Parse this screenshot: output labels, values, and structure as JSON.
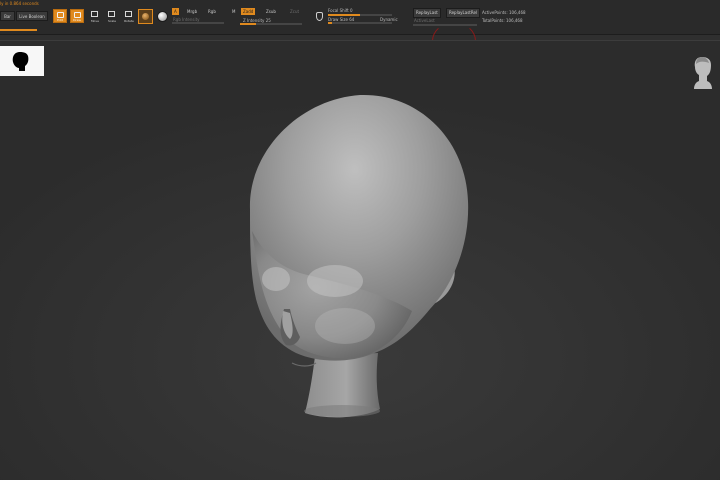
{
  "status": {
    "message": "ly in 0.864 seconds",
    "progress_fraction": 0.05
  },
  "left_buttons": {
    "clear_label": "Bar",
    "live_boolean_label": "Live Boolean"
  },
  "tools": [
    {
      "label": "Edit",
      "icon": "edit-icon",
      "active": true
    },
    {
      "label": "Draw",
      "icon": "draw-icon",
      "active": true
    },
    {
      "label": "Move",
      "icon": "move-icon",
      "active": false
    },
    {
      "label": "Scale",
      "icon": "scale-icon",
      "active": false
    },
    {
      "label": "Rotate",
      "icon": "rotate-icon",
      "active": false
    }
  ],
  "brush": {
    "brush_icon": "clay-brush-icon",
    "alpha_icon": "alpha-icon",
    "material_icon": "material-sphere-icon"
  },
  "modes": {
    "a_label": "A",
    "mrgb_label": "Mrgb",
    "rgb_label": "Rgb",
    "m_label": "M",
    "zadd_label": "Zadd",
    "zsub_label": "Zsub",
    "zcut_label": "Zcut",
    "rgb_intensity_label": "Rgb Intensity",
    "z_intensity_label": "Z Intensity 25",
    "z_intensity_value": 25,
    "z_intensity_fraction": 0.25
  },
  "brush_settings": {
    "focal_shift_label": "Focal Shift 0",
    "draw_size_label": "Draw Size 64",
    "dynamic_label": "Dynamic",
    "focal_shift_fraction": 0.5,
    "draw_size_fraction": 0.06
  },
  "replay": {
    "replay_last_label": "ReplayLast",
    "replay_last_rel_label": "ReplayLastRel",
    "active_label": "ActiveLast"
  },
  "stats": {
    "active_points": "ActivePoints: 106,468",
    "total_points": "TotalPoints: 106,468"
  },
  "colors": {
    "accent": "#e08a1e",
    "background": "#2f2f2f",
    "marker": "#d81e1e"
  },
  "canvas": {
    "model": "sculpted head bust",
    "thumbnail_icon": "head-silhouette-icon",
    "nav_icon": "navigation-head-icon"
  }
}
